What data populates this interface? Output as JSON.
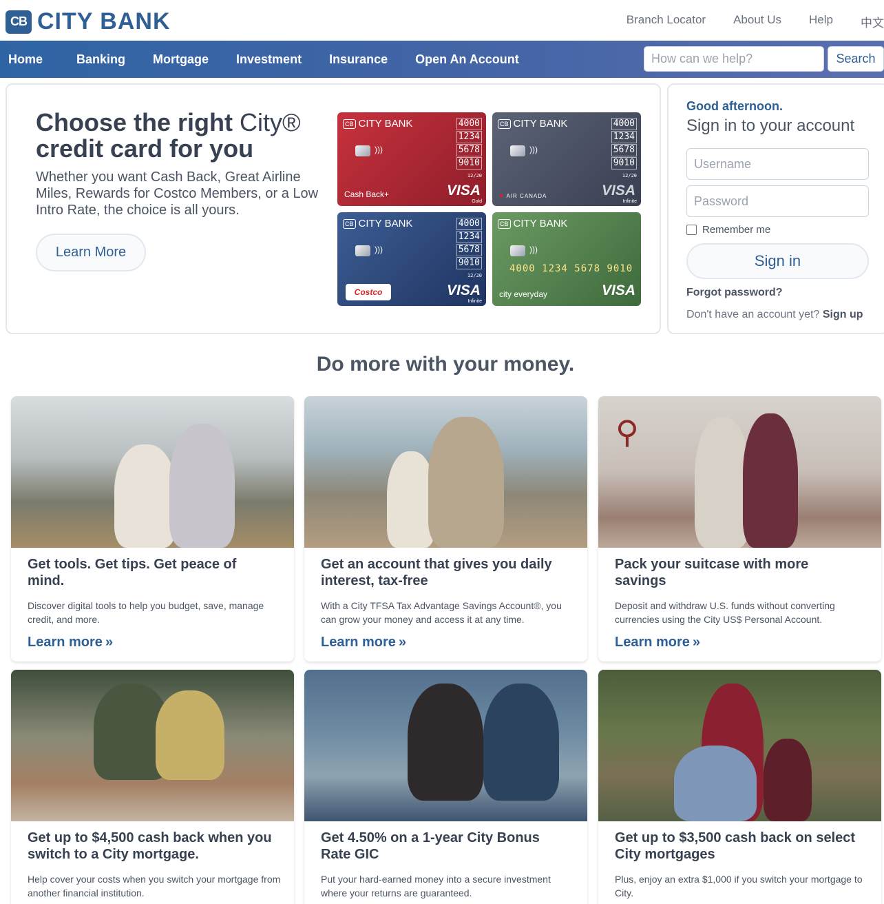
{
  "brand": {
    "logo_mark": "CB",
    "name": "CITY BANK"
  },
  "top_links": [
    "Branch Locator",
    "About Us",
    "Help",
    "中文"
  ],
  "nav": {
    "items": [
      "Home",
      "Banking",
      "Mortgage",
      "Investment",
      "Insurance",
      "Open An Account"
    ],
    "search_placeholder": "How can we help?",
    "search_button": "Search"
  },
  "hero": {
    "title_part1": "Choose the right ",
    "title_brand": "City®",
    "title_part2": "credit card for you",
    "description": "Whether you want Cash Back, Great Airline Miles, Rewards for Costco Members, or a Low Intro Rate, the choice is all yours.",
    "button": "Learn More",
    "cards": [
      {
        "bank": "CITY BANK",
        "mark": "CB",
        "numbers": [
          "4000",
          "1234",
          "5678",
          "9010"
        ],
        "expiry": "12/20",
        "name": "Cash Back+",
        "network": "VISA",
        "tier": "Gold",
        "color": "#b32430"
      },
      {
        "bank": "CITY BANK",
        "mark": "CB",
        "numbers": [
          "4000",
          "1234",
          "5678",
          "9010"
        ],
        "expiry": "12/20",
        "name": "AIR CANADA",
        "network": "VISA",
        "tier": "Infinite",
        "color": "#4a5064"
      },
      {
        "bank": "CITY BANK",
        "mark": "CB",
        "numbers": [
          "4000",
          "1234",
          "5678",
          "9010"
        ],
        "expiry": "12/20",
        "name": "Costco",
        "network": "VISA",
        "tier": "Infinite",
        "color": "#2c4a7c"
      },
      {
        "bank": "CITY BANK",
        "mark": "CB",
        "number_line": "4000 1234 5678 9010",
        "name": "city everyday",
        "network": "VISA",
        "color": "#5a8756"
      }
    ]
  },
  "signin": {
    "greeting": "Good afternoon.",
    "title": "Sign in to your account",
    "username_placeholder": "Username",
    "password_placeholder": "Password",
    "remember": "Remember me",
    "button": "Sign in",
    "forgot": "Forgot password?",
    "no_account": "Don't have an account yet?",
    "signup": "Sign up"
  },
  "section_title": "Do more with your money.",
  "tiles": [
    {
      "heading": "Get tools. Get tips. Get peace of mind.",
      "description": "Discover digital tools to help you budget, save, manage credit, and more.",
      "link": "Learn more"
    },
    {
      "heading": "Get an account that gives you daily interest, tax-free",
      "description": "With a City TFSA Tax Advantage Savings Account®, you can grow your money and access it at any time.",
      "link": "Learn more"
    },
    {
      "heading": "Pack your suitcase with more savings",
      "description": "Deposit and withdraw U.S. funds without converting currencies using the City US$ Personal Account.",
      "link": "Learn more"
    },
    {
      "heading": "Get up to $4,500 cash back when you switch to a City mortgage.",
      "description": "Help cover your costs when you switch your mortgage from another financial institution."
    },
    {
      "heading": "Get 4.50% on a 1-year City Bonus Rate GIC",
      "description": "Put your hard-earned money into a secure investment where your returns are guaranteed."
    },
    {
      "heading": "Get up to $3,500 cash back on select City mortgages",
      "description": "Plus, enjoy an extra $1,000 if you switch your mortgage to City."
    }
  ],
  "colors": {
    "brand": "#2e5f95",
    "nav_bg": "#3f65a6"
  },
  "icons": {
    "link_arrow": "double-chevron-right-icon",
    "contactless": "contactless-icon",
    "chip": "chip-icon"
  }
}
